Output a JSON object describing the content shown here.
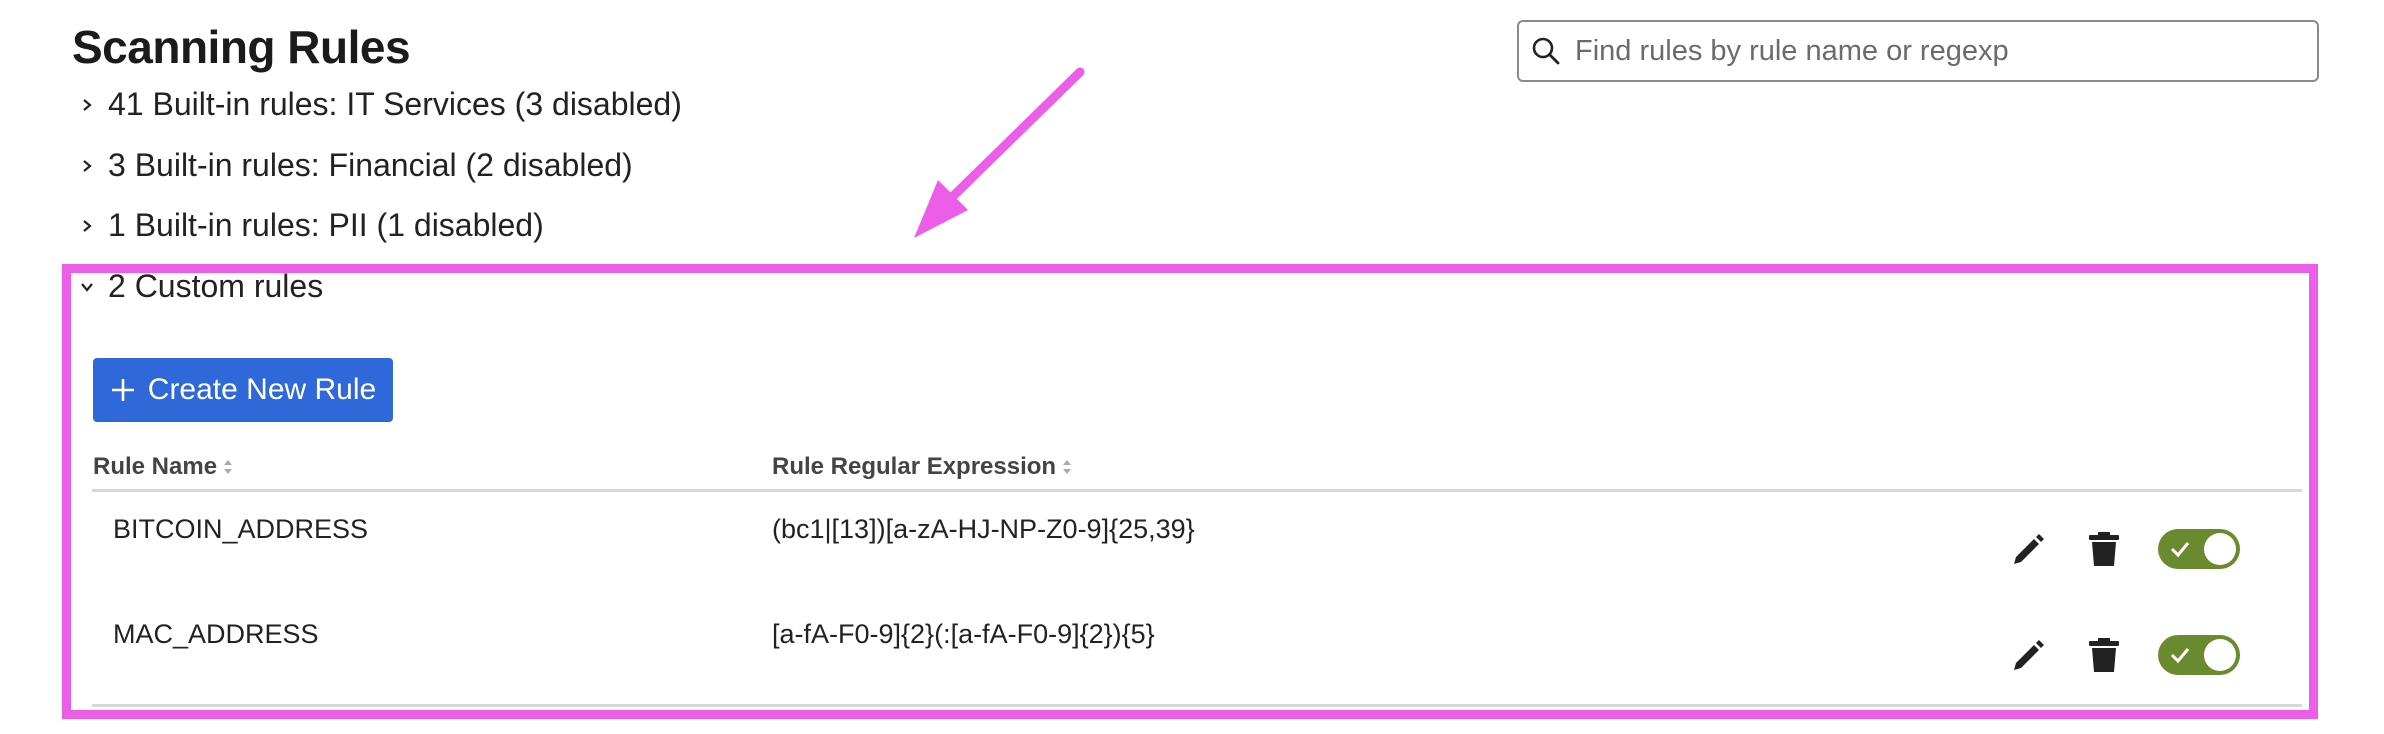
{
  "page": {
    "title": "Scanning Rules"
  },
  "search": {
    "placeholder": "Find rules by rule name or regexp",
    "value": ""
  },
  "groups": [
    {
      "label": "41 Built-in rules: IT Services (3 disabled)",
      "expanded": false
    },
    {
      "label": "3 Built-in rules: Financial (2 disabled)",
      "expanded": false
    },
    {
      "label": "1 Built-in rules: PII (1 disabled)",
      "expanded": false
    },
    {
      "label": "2 Custom rules",
      "expanded": true
    }
  ],
  "custom": {
    "create_button_label": "Create New Rule",
    "columns": {
      "name": "Rule Name",
      "regex": "Rule Regular Expression"
    },
    "rows": [
      {
        "name": "BITCOIN_ADDRESS",
        "regex": "(bc1|[13])[a-zA-HJ-NP-Z0-9]{25,39}",
        "enabled": true
      },
      {
        "name": "MAC_ADDRESS",
        "regex": "[a-fA-F0-9]{2}(:[a-fA-F0-9]{2}){5}",
        "enabled": true
      }
    ]
  },
  "icons": {
    "search": "search-icon",
    "chevron_right": "chevron-right-icon",
    "chevron_down": "chevron-down-icon",
    "plus": "plus-icon",
    "sort": "sort-icon",
    "edit": "pencil-icon",
    "delete": "trash-icon",
    "toggle_on": "check-icon"
  },
  "colors": {
    "accent_button": "#2f68d8",
    "toggle_on": "#6a8a30",
    "annotation": "#ec5de8"
  }
}
